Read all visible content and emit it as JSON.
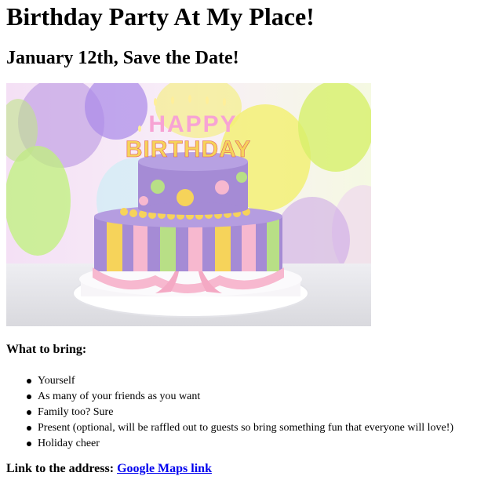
{
  "page": {
    "title": "Birthday Party At My Place!",
    "subtitle": "January 12th, Save the Date!"
  },
  "image": {
    "alt": "Birthday cake",
    "topper_line1": "HAPPY",
    "topper_line2": "BIRTHDAY",
    "colors": {
      "background": "#f3e7f3",
      "balloon_purple": "#b58fe0",
      "balloon_yellow": "#f4ef6a",
      "balloon_green": "#bff27b",
      "cake_purple": "#a58bd5",
      "cake_pink": "#f7b8cf",
      "cake_yellow": "#f6d35a",
      "cake_green": "#b8df86",
      "plate": "#f7f5f8"
    }
  },
  "bring": {
    "heading": "What to bring:",
    "items": [
      "Yourself",
      "As many of your friends as you want",
      "Family too? Sure",
      "Present (optional, will be raffled out to guests so bring something fun that everyone will love!)",
      "Holiday cheer"
    ]
  },
  "address": {
    "label": "Link to the address:",
    "link_text": "Google Maps link"
  }
}
